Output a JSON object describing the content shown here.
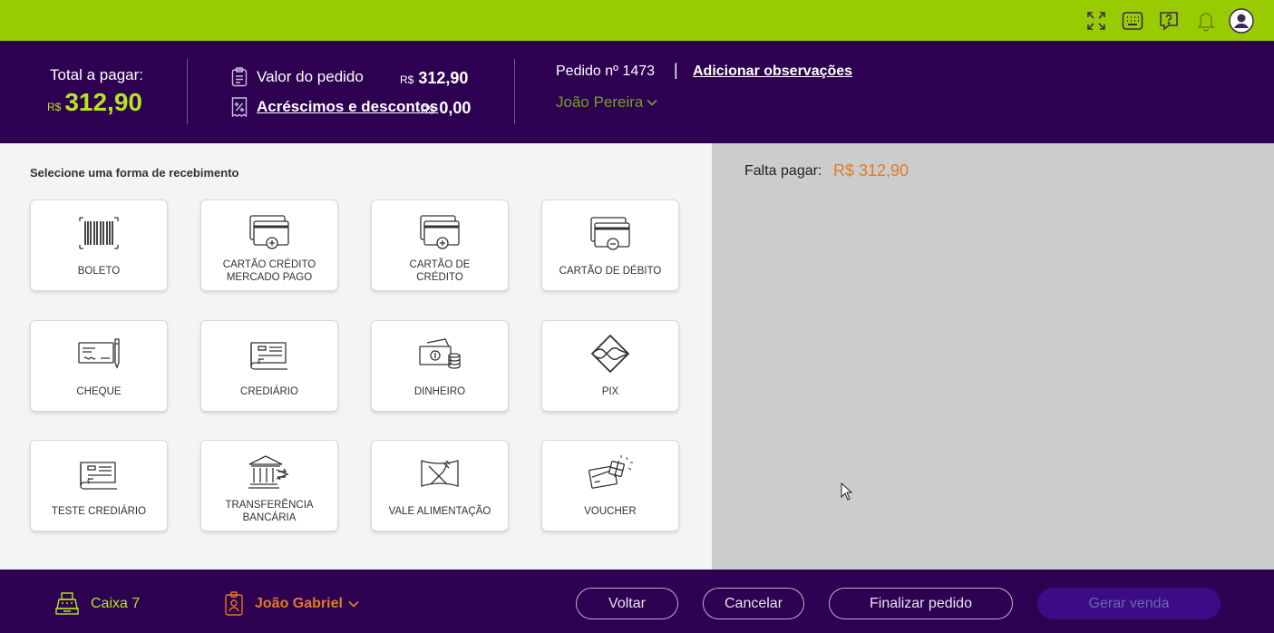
{
  "topbar": {
    "icons": [
      "fullscreen-icon",
      "keyboard-icon",
      "help-chat-icon",
      "bell-icon",
      "user-avatar-icon"
    ]
  },
  "header": {
    "total_label": "Total a pagar:",
    "currency": "R$",
    "total_value": "312,90",
    "valor_pedido_label": "Valor do pedido",
    "valor_pedido_value": "312,90",
    "acrescimos_label": "Acréscimos e descontos",
    "acrescimos_value": "0,00",
    "pedido_label": "Pedido nº 1473",
    "pipe": "|",
    "observacoes_link": "Adicionar observações",
    "cliente_name": "João Pereira"
  },
  "main": {
    "section_title": "Selecione uma forma de recebimento",
    "payment_methods": [
      {
        "line1": "BOLETO",
        "line2": "",
        "icon": "barcode-icon"
      },
      {
        "line1": "CARTÃO CRÉDITO",
        "line2": "MERCADO PAGO",
        "icon": "credit-card-plus-icon"
      },
      {
        "line1": "CARTÃO DE",
        "line2": "CRÉDITO",
        "icon": "credit-card-plus-icon"
      },
      {
        "line1": "CARTÃO DE DÉBITO",
        "line2": "",
        "icon": "debit-card-minus-icon"
      },
      {
        "line1": "CHEQUE",
        "line2": "",
        "icon": "cheque-pen-icon"
      },
      {
        "line1": "CREDIÁRIO",
        "line2": "",
        "icon": "crediario-icon"
      },
      {
        "line1": "DINHEIRO",
        "line2": "",
        "icon": "cash-coins-icon"
      },
      {
        "line1": "PIX",
        "line2": "",
        "icon": "pix-icon"
      },
      {
        "line1": "TESTE CREDIÁRIO",
        "line2": "",
        "icon": "crediario-icon"
      },
      {
        "line1": "TRANSFERÊNCIA",
        "line2": "BANCÁRIA",
        "icon": "bank-transfer-icon"
      },
      {
        "line1": "VALE ALIMENTAÇÃO",
        "line2": "",
        "icon": "fork-knife-icon"
      },
      {
        "line1": "VOUCHER",
        "line2": "",
        "icon": "gift-card-icon"
      }
    ]
  },
  "side": {
    "falta_label": "Falta pagar:",
    "falta_value": "R$ 312,90"
  },
  "footer": {
    "caixa_label": "Caixa 7",
    "operador_name": "João Gabriel",
    "voltar_label": "Voltar",
    "cancelar_label": "Cancelar",
    "finalizar_label": "Finalizar pedido",
    "gerar_label": "Gerar venda"
  },
  "colors": {
    "topbar": "#99cc00",
    "header": "#2d0052",
    "accent_green": "#b5e61d",
    "accent_orange": "#e07b22",
    "right_panel": "#cccccc"
  }
}
